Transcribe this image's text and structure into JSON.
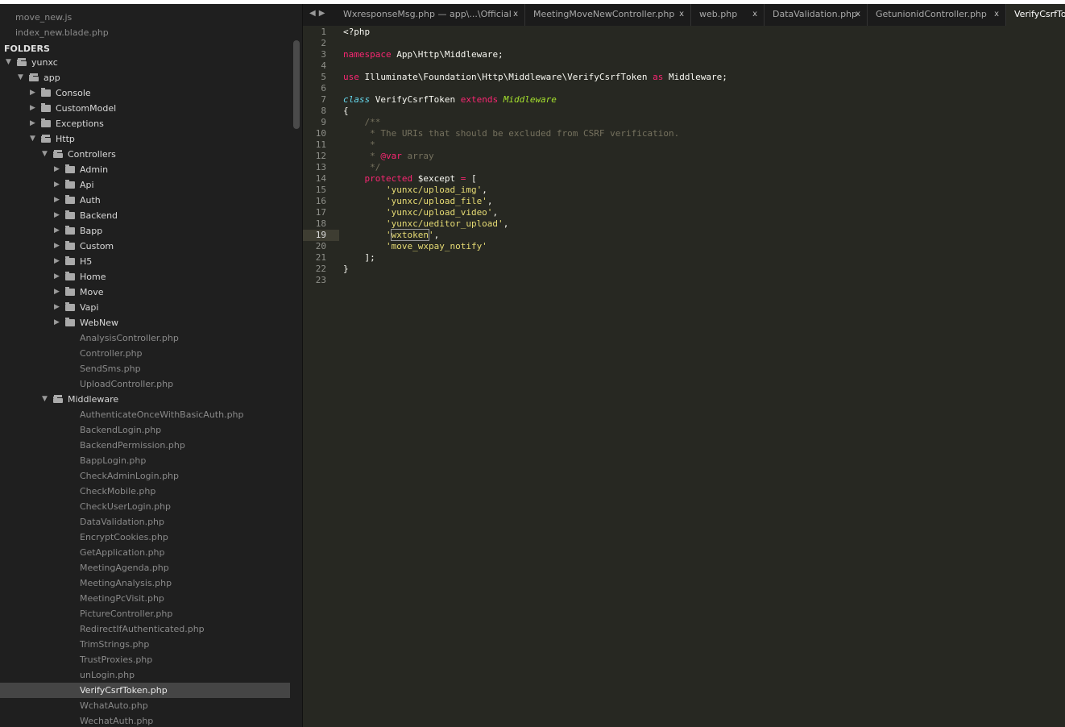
{
  "sidebar": {
    "open_files": [
      "move_new.js",
      "index_new.blade.php"
    ],
    "folders_header": "FOLDERS",
    "tree": [
      {
        "label": "yunxc",
        "type": "folder-open",
        "depth": 0
      },
      {
        "label": "app",
        "type": "folder-open",
        "depth": 1
      },
      {
        "label": "Console",
        "type": "folder",
        "depth": 2
      },
      {
        "label": "CustomModel",
        "type": "folder",
        "depth": 2
      },
      {
        "label": "Exceptions",
        "type": "folder",
        "depth": 2
      },
      {
        "label": "Http",
        "type": "folder-open",
        "depth": 2
      },
      {
        "label": "Controllers",
        "type": "folder-open",
        "depth": 3
      },
      {
        "label": "Admin",
        "type": "folder",
        "depth": 4
      },
      {
        "label": "Api",
        "type": "folder",
        "depth": 4
      },
      {
        "label": "Auth",
        "type": "folder",
        "depth": 4
      },
      {
        "label": "Backend",
        "type": "folder",
        "depth": 4
      },
      {
        "label": "Bapp",
        "type": "folder",
        "depth": 4
      },
      {
        "label": "Custom",
        "type": "folder",
        "depth": 4
      },
      {
        "label": "H5",
        "type": "folder",
        "depth": 4
      },
      {
        "label": "Home",
        "type": "folder",
        "depth": 4
      },
      {
        "label": "Move",
        "type": "folder",
        "depth": 4
      },
      {
        "label": "Vapi",
        "type": "folder",
        "depth": 4
      },
      {
        "label": "WebNew",
        "type": "folder",
        "depth": 4
      },
      {
        "label": "AnalysisController.php",
        "type": "file",
        "depth": 4
      },
      {
        "label": "Controller.php",
        "type": "file",
        "depth": 4
      },
      {
        "label": "SendSms.php",
        "type": "file",
        "depth": 4
      },
      {
        "label": "UploadController.php",
        "type": "file",
        "depth": 4
      },
      {
        "label": "Middleware",
        "type": "folder-open",
        "depth": 3
      },
      {
        "label": "AuthenticateOnceWithBasicAuth.php",
        "type": "file",
        "depth": 4
      },
      {
        "label": "BackendLogin.php",
        "type": "file",
        "depth": 4
      },
      {
        "label": "BackendPermission.php",
        "type": "file",
        "depth": 4
      },
      {
        "label": "BappLogin.php",
        "type": "file",
        "depth": 4
      },
      {
        "label": "CheckAdminLogin.php",
        "type": "file",
        "depth": 4
      },
      {
        "label": "CheckMobile.php",
        "type": "file",
        "depth": 4
      },
      {
        "label": "CheckUserLogin.php",
        "type": "file",
        "depth": 4
      },
      {
        "label": "DataValidation.php",
        "type": "file",
        "depth": 4
      },
      {
        "label": "EncryptCookies.php",
        "type": "file",
        "depth": 4
      },
      {
        "label": "GetApplication.php",
        "type": "file",
        "depth": 4
      },
      {
        "label": "MeetingAgenda.php",
        "type": "file",
        "depth": 4
      },
      {
        "label": "MeetingAnalysis.php",
        "type": "file",
        "depth": 4
      },
      {
        "label": "MeetingPcVisit.php",
        "type": "file",
        "depth": 4
      },
      {
        "label": "PictureController.php",
        "type": "file",
        "depth": 4
      },
      {
        "label": "RedirectIfAuthenticated.php",
        "type": "file",
        "depth": 4
      },
      {
        "label": "TrimStrings.php",
        "type": "file",
        "depth": 4
      },
      {
        "label": "TrustProxies.php",
        "type": "file",
        "depth": 4
      },
      {
        "label": "unLogin.php",
        "type": "file",
        "depth": 4
      },
      {
        "label": "VerifyCsrfToken.php",
        "type": "file",
        "depth": 4,
        "selected": true
      },
      {
        "label": "WchatAuto.php",
        "type": "file",
        "depth": 4
      },
      {
        "label": "WechatAuth.php",
        "type": "file",
        "depth": 4
      }
    ]
  },
  "tabs": [
    {
      "label": "WxresponseMsg.php — app\\...\\Official",
      "close": "x"
    },
    {
      "label": "MeetingMoveNewController.php",
      "close": "x"
    },
    {
      "label": "web.php",
      "close": "x"
    },
    {
      "label": "DataValidation.php",
      "close": "x"
    },
    {
      "label": "GetunionidController.php",
      "close": "x"
    },
    {
      "label": "VerifyCsrfToken.php",
      "active": true
    }
  ],
  "editor": {
    "current_line": 19,
    "lines": [
      [
        [
          "<?php",
          "pl"
        ]
      ],
      [],
      [
        [
          "namespace",
          "kw"
        ],
        [
          " App\\Http\\Middleware;",
          "pl"
        ]
      ],
      [],
      [
        [
          "use",
          "kw"
        ],
        [
          " Illuminate\\Foundation\\Http\\Middleware\\VerifyCsrfToken ",
          "pl"
        ],
        [
          "as",
          "kw"
        ],
        [
          " Middleware;",
          "pl"
        ]
      ],
      [],
      [
        [
          "class",
          "sto"
        ],
        [
          " VerifyCsrfToken ",
          "pl"
        ],
        [
          "extends",
          "kw"
        ],
        [
          " ",
          "pl"
        ],
        [
          "Middleware",
          "cl"
        ]
      ],
      [
        [
          "{",
          "pl"
        ]
      ],
      [
        [
          "    /**",
          "cm"
        ]
      ],
      [
        [
          "     * The URIs that should be excluded from CSRF verification.",
          "cm"
        ]
      ],
      [
        [
          "     *",
          "cm"
        ]
      ],
      [
        [
          "     * ",
          "cm"
        ],
        [
          "@var",
          "kw"
        ],
        [
          " array",
          "cm"
        ]
      ],
      [
        [
          "     */",
          "cm"
        ]
      ],
      [
        [
          "    ",
          "pl"
        ],
        [
          "protected",
          "kw"
        ],
        [
          " $except ",
          "pl"
        ],
        [
          "=",
          "kw"
        ],
        [
          " [",
          "pl"
        ]
      ],
      [
        [
          "        'yunxc/upload_img'",
          "st"
        ],
        [
          ",",
          "pl"
        ]
      ],
      [
        [
          "        'yunxc/upload_file'",
          "st"
        ],
        [
          ",",
          "pl"
        ]
      ],
      [
        [
          "        'yunxc/upload_video'",
          "st"
        ],
        [
          ",",
          "pl"
        ]
      ],
      [
        [
          "        'yunxc/ueditor_upload'",
          "st"
        ],
        [
          ",",
          "pl"
        ]
      ],
      [
        [
          "        '",
          "st"
        ],
        [
          "wxtoken",
          "st hl"
        ],
        [
          "'",
          "st"
        ],
        [
          ",",
          "pl"
        ]
      ],
      [
        [
          "        'move_wxpay_notify'",
          "st"
        ]
      ],
      [
        [
          "    ];",
          "pl"
        ]
      ],
      [
        [
          "}",
          "pl"
        ]
      ],
      []
    ]
  }
}
